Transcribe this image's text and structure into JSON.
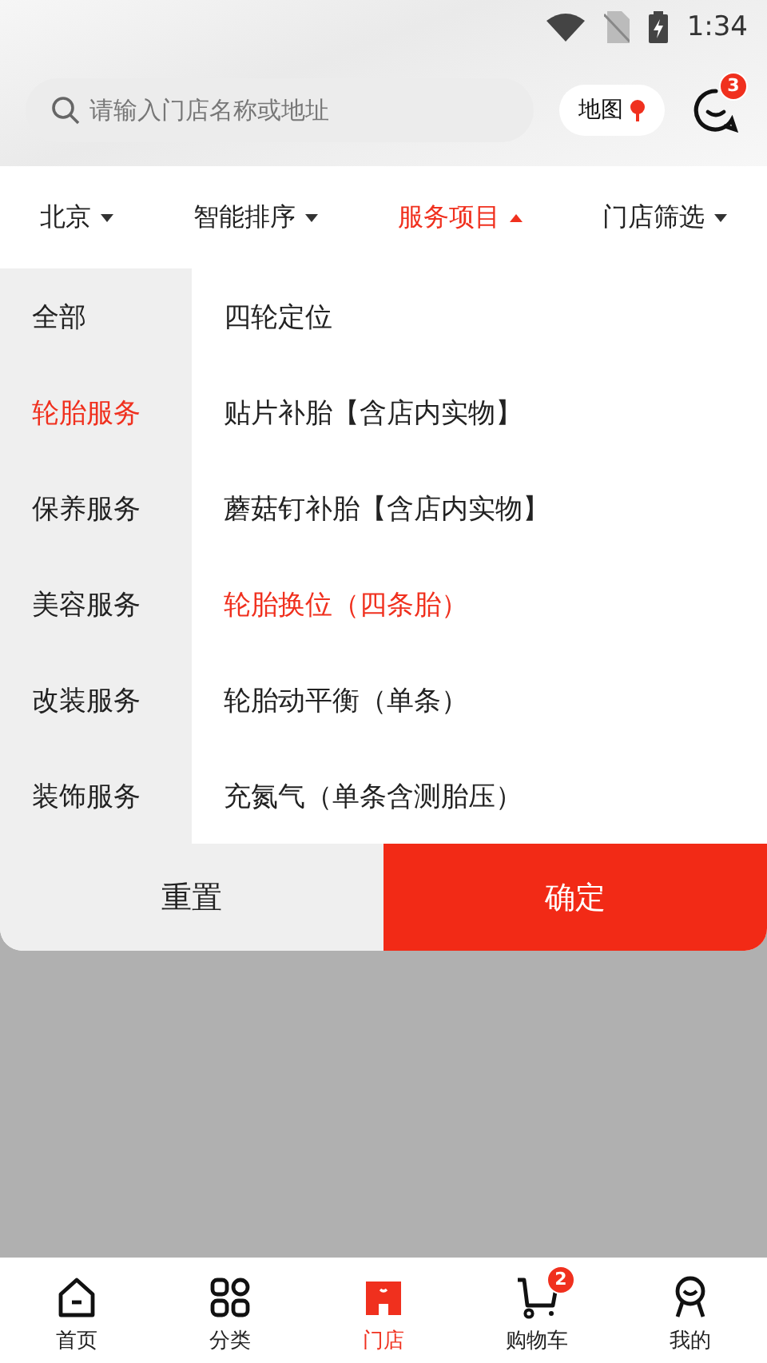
{
  "status_bar": {
    "time": "1:34"
  },
  "search": {
    "placeholder": "请输入门店名称或地址"
  },
  "map_button": {
    "label": "地图"
  },
  "messages": {
    "badge": "3"
  },
  "filters": [
    {
      "label": "北京",
      "selected": false
    },
    {
      "label": "智能排序",
      "selected": false
    },
    {
      "label": "服务项目",
      "selected": true
    },
    {
      "label": "门店筛选",
      "selected": false
    }
  ],
  "categories": [
    {
      "label": "全部",
      "selected": false
    },
    {
      "label": "轮胎服务",
      "selected": true
    },
    {
      "label": "保养服务",
      "selected": false
    },
    {
      "label": "美容服务",
      "selected": false
    },
    {
      "label": "改装服务",
      "selected": false
    },
    {
      "label": "装饰服务",
      "selected": false
    }
  ],
  "services": [
    {
      "label": "四轮定位",
      "selected": false
    },
    {
      "label": "贴片补胎【含店内实物】",
      "selected": false
    },
    {
      "label": "蘑菇钉补胎【含店内实物】",
      "selected": false
    },
    {
      "label": "轮胎换位（四条胎）",
      "selected": true
    },
    {
      "label": "轮胎动平衡（单条）",
      "selected": false
    },
    {
      "label": "充氮气（单条含测胎压）",
      "selected": false
    }
  ],
  "buttons": {
    "reset": "重置",
    "confirm": "确定"
  },
  "tab_bar": [
    {
      "kind": "home",
      "label": "首页",
      "selected": false
    },
    {
      "kind": "grid",
      "label": "分类",
      "selected": false
    },
    {
      "kind": "store",
      "label": "门店",
      "selected": true
    },
    {
      "kind": "cart",
      "label": "购物车",
      "selected": false,
      "badge": "2"
    },
    {
      "kind": "profile",
      "label": "我的",
      "selected": false
    }
  ]
}
